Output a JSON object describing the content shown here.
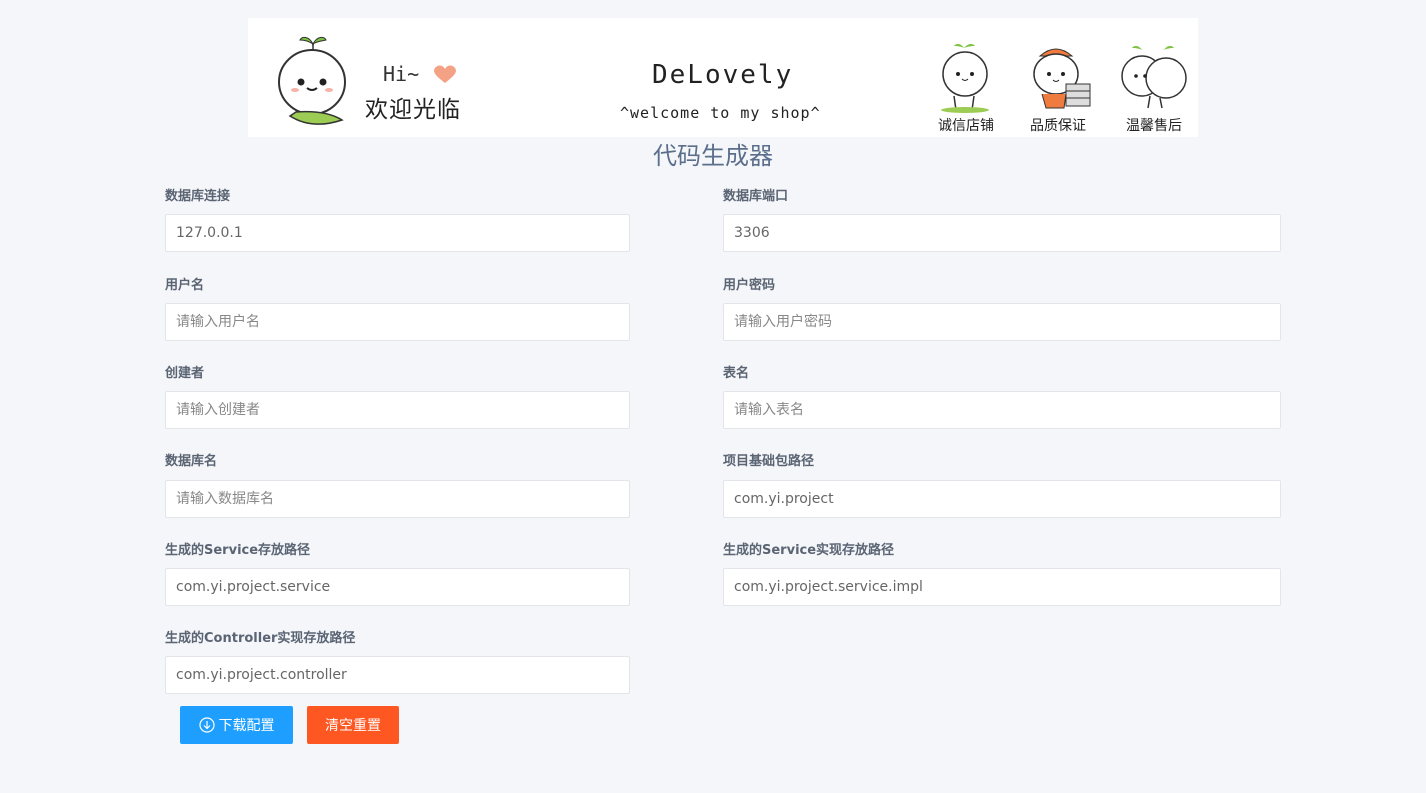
{
  "banner": {
    "greeting": "Hi~",
    "welcome_cn": "欢迎光临",
    "brand": "DeLovely",
    "slogan": "^welcome to my shop^",
    "features": [
      {
        "label": "诚信店铺",
        "icon": "mascot-thumbs-up-icon"
      },
      {
        "label": "品质保证",
        "icon": "mascot-delivery-icon"
      },
      {
        "label": "温馨售后",
        "icon": "mascot-hug-icon"
      }
    ]
  },
  "page": {
    "title": "代码生成器"
  },
  "form": {
    "db_url": {
      "label": "数据库连接",
      "value": "127.0.0.1",
      "placeholder": ""
    },
    "db_port": {
      "label": "数据库端口",
      "value": "3306",
      "placeholder": ""
    },
    "username": {
      "label": "用户名",
      "value": "",
      "placeholder": "请输入用户名"
    },
    "password": {
      "label": "用户密码",
      "value": "",
      "placeholder": "请输入用户密码"
    },
    "creator": {
      "label": "创建者",
      "value": "",
      "placeholder": "请输入创建者"
    },
    "table_name": {
      "label": "表名",
      "value": "",
      "placeholder": "请输入表名"
    },
    "db_name": {
      "label": "数据库名",
      "value": "",
      "placeholder": "请输入数据库名"
    },
    "base_package": {
      "label": "项目基础包路径",
      "value": "com.yi.project",
      "placeholder": ""
    },
    "service_path": {
      "label": "生成的Service存放路径",
      "value": "com.yi.project.service",
      "placeholder": ""
    },
    "service_impl_path": {
      "label": "生成的Service实现存放路径",
      "value": "com.yi.project.service.impl",
      "placeholder": ""
    },
    "controller_path": {
      "label": "生成的Controller实现存放路径",
      "value": "com.yi.project.controller",
      "placeholder": ""
    }
  },
  "actions": {
    "download_label": "下载配置",
    "download_icon": "download-circle-icon",
    "reset_label": "清空重置",
    "download_color": "#1e9fff",
    "reset_color": "#ff5722"
  }
}
